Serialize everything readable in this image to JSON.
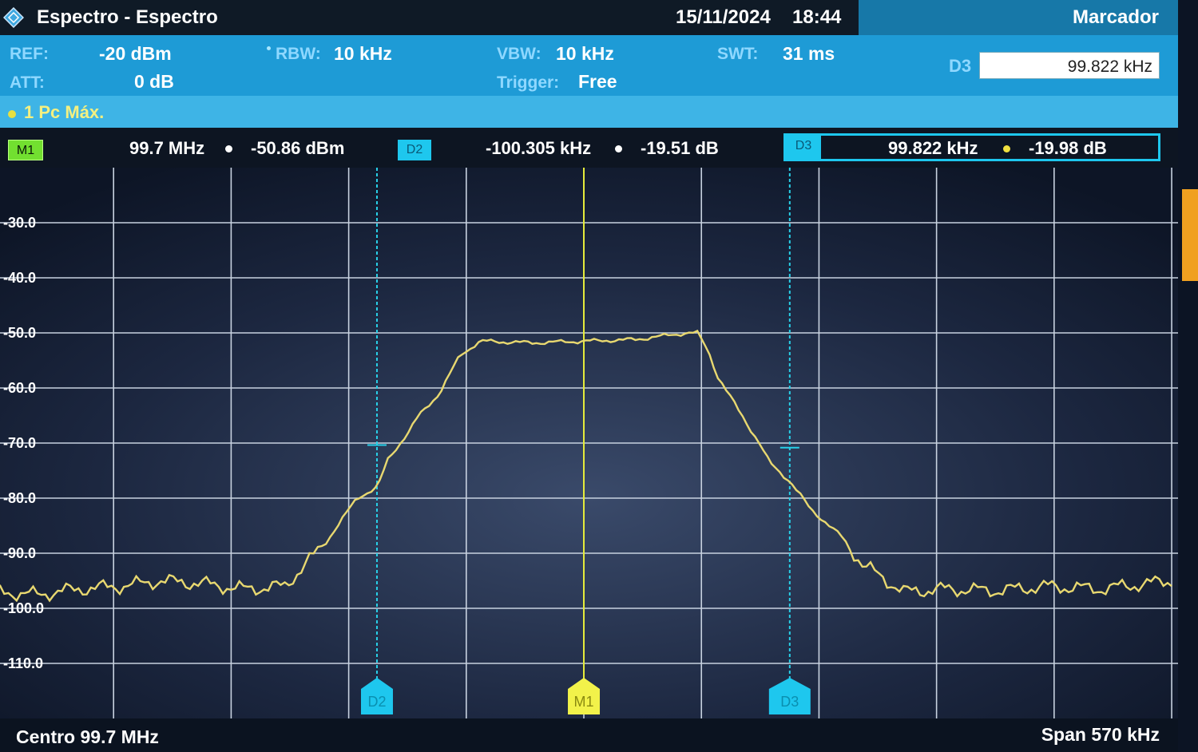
{
  "header": {
    "app_title": "Espectro - Espectro",
    "date": "15/11/2024",
    "time": "18:44",
    "panel_title": "Marcador"
  },
  "params": {
    "ref_label": "REF:",
    "ref_value": "-20 dBm",
    "att_label": "ATT:",
    "att_value": "0 dB",
    "rbw_label": "RBW:",
    "rbw_value": "10 kHz",
    "vbw_label": "VBW:",
    "vbw_value": "10 kHz",
    "trigger_label": "Trigger:",
    "trigger_value": "Free",
    "swt_label": "SWT:",
    "swt_value": "31 ms"
  },
  "marker_panel": {
    "label": "D3",
    "value": "99.822 kHz"
  },
  "trace": {
    "label": "1 Pc Máx."
  },
  "markers": [
    {
      "id": "M1",
      "x_value": "99.7 MHz",
      "y_value": "-50.86 dBm",
      "color": "#8cf23c"
    },
    {
      "id": "D2",
      "x_value": "-100.305 kHz",
      "y_value": "-19.51 dB",
      "color": "#1ec7ee"
    },
    {
      "id": "D3",
      "x_value": "99.822 kHz",
      "y_value": "-19.98 dB",
      "color": "#1ec7ee"
    }
  ],
  "footer": {
    "center": "Centro 99.7 MHz",
    "span": "Span 570 kHz"
  },
  "colors": {
    "trace": "#e8d870",
    "m1": "#e6ec3a",
    "delta": "#28d0e8",
    "grid": "#c8d2e0"
  },
  "chart_data": {
    "type": "line",
    "center_mhz": 99.7,
    "span_khz": 570,
    "xlim": [
      -285,
      285
    ],
    "ylim": [
      -120,
      -20
    ],
    "y_tick_labels": [
      "-30.0",
      "-40.0",
      "-50.0",
      "-60.0",
      "-70.0",
      "-80.0",
      "-90.0",
      "-100.0",
      "-110.0"
    ],
    "y_ticks": [
      -30,
      -40,
      -50,
      -60,
      -70,
      -80,
      -90,
      -100,
      -110
    ],
    "grid": true,
    "x": [
      -285,
      -265,
      -245,
      -225,
      -205,
      -185,
      -165,
      -145,
      -125,
      -110,
      -100,
      -95,
      -85,
      -80,
      -70,
      -60,
      -50,
      -25,
      0,
      25,
      50,
      55,
      60,
      65,
      70,
      75,
      80,
      85,
      90,
      100,
      110,
      125,
      135,
      155,
      175,
      200,
      225,
      250,
      285
    ],
    "y": [
      -97,
      -97.5,
      -96.5,
      -96,
      -95,
      -95.5,
      -96.5,
      -96,
      -88,
      -80,
      -78,
      -73,
      -68,
      -65,
      -61,
      -54,
      -51.5,
      -51.8,
      -51.5,
      -51.2,
      -50,
      -50,
      -53,
      -58,
      -61,
      -64,
      -67,
      -70,
      -73.5,
      -77,
      -82,
      -87,
      -92,
      -97,
      -96.5,
      -96.8,
      -96,
      -96.5,
      -95
    ],
    "markers": [
      {
        "id": "M1",
        "x": 0,
        "y": -50.86
      },
      {
        "id": "D2",
        "x": -100.305,
        "y": -70.37
      },
      {
        "id": "D3",
        "x": 99.822,
        "y": -70.84
      }
    ]
  }
}
